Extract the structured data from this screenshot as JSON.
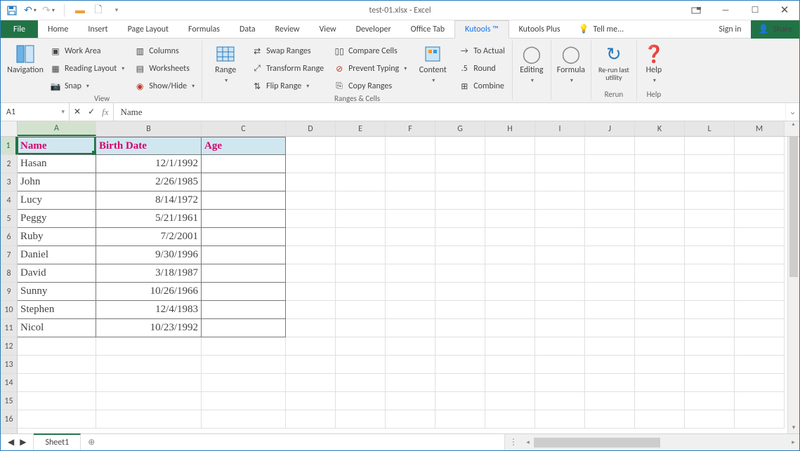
{
  "title": "test-01.xlsx - Excel",
  "qat": {
    "save": "💾",
    "undo": "↶",
    "redo": "↷",
    "open": "📂",
    "new": "🗋"
  },
  "tabs": {
    "file": "File",
    "home": "Home",
    "insert": "Insert",
    "page_layout": "Page Layout",
    "formulas": "Formulas",
    "data": "Data",
    "review": "Review",
    "view": "View",
    "developer": "Developer",
    "office_tab": "Office Tab",
    "kutools": "Kutools ™",
    "kutools_plus": "Kutools Plus",
    "tellme": "Tell me...",
    "signin": "Sign in",
    "share": "Share"
  },
  "ribbon": {
    "navigation": "Navigation",
    "view_group": "View",
    "work_area": "Work Area",
    "reading_layout": "Reading Layout",
    "snap": "Snap",
    "columns": "Columns",
    "worksheets": "Worksheets",
    "show_hide": "Show/Hide",
    "range": "Range",
    "ranges_cells": "Ranges & Cells",
    "swap_ranges": "Swap Ranges",
    "transform_range": "Transform Range",
    "flip_range": "Flip Range",
    "compare_cells": "Compare Cells",
    "prevent_typing": "Prevent Typing",
    "copy_ranges": "Copy Ranges",
    "content": "Content",
    "to_actual": "To Actual",
    "round": "Round",
    "combine": "Combine",
    "editing": "Editing",
    "formula": "Formula",
    "rerun": "Re-run last utility",
    "rerun_label": "Rerun",
    "help": "Help"
  },
  "fbar": {
    "cell_ref": "A1",
    "value": "Name"
  },
  "columns": [
    "A",
    "B",
    "C",
    "D",
    "E",
    "F",
    "G",
    "H",
    "I",
    "J",
    "K",
    "L",
    "M"
  ],
  "col_widths": {
    "data": [
      112,
      150,
      120
    ],
    "default": 71
  },
  "row_headers": [
    "1",
    "2",
    "3",
    "4",
    "5",
    "6",
    "7",
    "8",
    "9",
    "10",
    "11",
    "12",
    "13",
    "14",
    "15",
    "16"
  ],
  "headers": {
    "name": "Name",
    "birth": "Birth Date",
    "age": "Age"
  },
  "rows": [
    {
      "name": "Hasan",
      "birth": "12/1/1992",
      "age": ""
    },
    {
      "name": "John",
      "birth": "2/26/1985",
      "age": ""
    },
    {
      "name": "Lucy",
      "birth": "8/14/1972",
      "age": ""
    },
    {
      "name": "Peggy",
      "birth": "5/21/1961",
      "age": ""
    },
    {
      "name": "Ruby",
      "birth": "7/2/2001",
      "age": ""
    },
    {
      "name": "Daniel",
      "birth": "9/30/1996",
      "age": ""
    },
    {
      "name": "David",
      "birth": "3/18/1987",
      "age": ""
    },
    {
      "name": "Sunny",
      "birth": "10/26/1966",
      "age": ""
    },
    {
      "name": "Stephen",
      "birth": "12/4/1983",
      "age": ""
    },
    {
      "name": "Nicol",
      "birth": "10/23/1992",
      "age": ""
    }
  ],
  "sheet": {
    "name": "Sheet1"
  },
  "active_cell": "A1"
}
